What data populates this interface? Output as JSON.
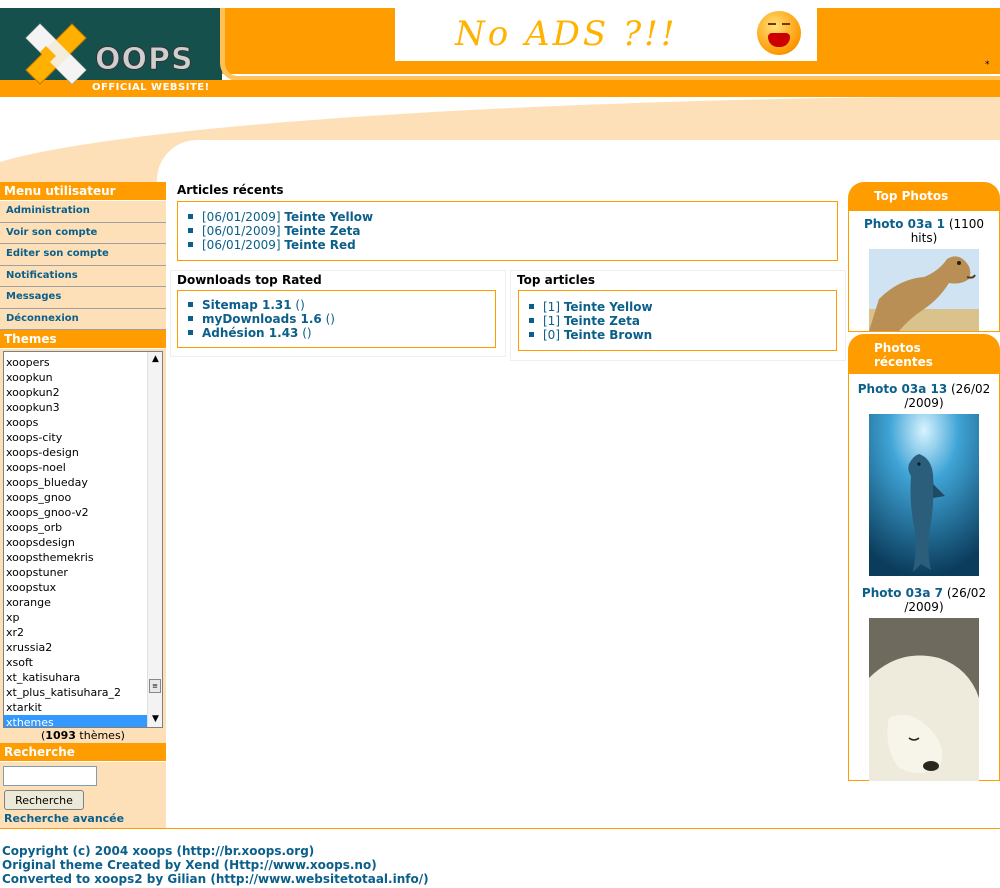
{
  "header": {
    "logo_word": "OOPS",
    "logo_subtitle": "OFFICIAL WEBSITE!",
    "ad_text": "No ADS ?!!",
    "ad_corner_mark": "*"
  },
  "left": {
    "user_menu_title": "Menu utilisateur",
    "user_menu_items": [
      "Administration",
      "Voir son compte",
      "Editer son compte",
      "Notifications",
      "Messages",
      "Déconnexion"
    ],
    "themes_title": "Themes",
    "themes_list": [
      "xoopers",
      "xoopkun",
      "xoopkun2",
      "xoopkun3",
      "xoops",
      "xoops-city",
      "xoops-design",
      "xoops-noel",
      "xoops_blueday",
      "xoops_gnoo",
      "xoops_gnoo-v2",
      "xoops_orb",
      "xoopsdesign",
      "xoopsthemekris",
      "xoopstuner",
      "xoopstux",
      "xorange",
      "xp",
      "xr2",
      "xrussia2",
      "xsoft",
      "xt_katisuhara",
      "xt_plus_katisuhara_2",
      "xtarkit",
      "xthemes"
    ],
    "themes_selected": "xthemes",
    "themes_count_prefix": "(",
    "themes_count": "1093",
    "themes_count_suffix": " thèmes)",
    "search_title": "Recherche",
    "search_value": "",
    "search_button": "Recherche",
    "advanced_search": "Recherche avancée"
  },
  "center": {
    "recent_articles_title": "Articles récents",
    "recent_articles": [
      {
        "date": "[06/01/2009]",
        "title": "Teinte Yellow"
      },
      {
        "date": "[06/01/2009]",
        "title": "Teinte Zeta"
      },
      {
        "date": "[06/01/2009]",
        "title": "Teinte Red"
      }
    ],
    "downloads_title": "Downloads top Rated",
    "downloads": [
      {
        "name": "Sitemap 1.31",
        "extra": " ()"
      },
      {
        "name": "myDownloads 1.6",
        "extra": " ()"
      },
      {
        "name": "Adhésion 1.43",
        "extra": " ()"
      }
    ],
    "top_articles_title": "Top articles",
    "top_articles": [
      {
        "count": "[1]",
        "title": "Teinte Yellow"
      },
      {
        "count": "[1]",
        "title": "Teinte Zeta"
      },
      {
        "count": "[0]",
        "title": "Teinte Brown"
      }
    ]
  },
  "right": {
    "top_photos_title": "Top Photos",
    "top_photo": {
      "title": "Photo 03a 1",
      "meta_a": " (1100",
      "meta_b": "hits)",
      "icon": "camel-photo"
    },
    "recent_photos_title_a": "Photos",
    "recent_photos_title_b": "récentes",
    "recent_photos": [
      {
        "title": "Photo 03a 13",
        "meta_a": " (26/02",
        "meta_b": "/2009)",
        "icon": "dolphin-photo"
      },
      {
        "title": "Photo 03a 7",
        "meta_a": " (26/02",
        "meta_b": "/2009)",
        "icon": "polar-bear-photo"
      }
    ]
  },
  "footer": {
    "lines": [
      "Copyright (c) 2004 xoops (http://br.xoops.org)",
      "Original theme Created by Xend (Http://www.xoops.no)",
      "Converted to xoops2 by Gilian (http://www.websitetotaal.info/)"
    ]
  },
  "colors": {
    "brand_orange": "#ff9c00",
    "peach": "#fde0b7",
    "teal": "#15504c",
    "link_blue": "#0b5f8a",
    "selected_blue": "#3399ff"
  }
}
